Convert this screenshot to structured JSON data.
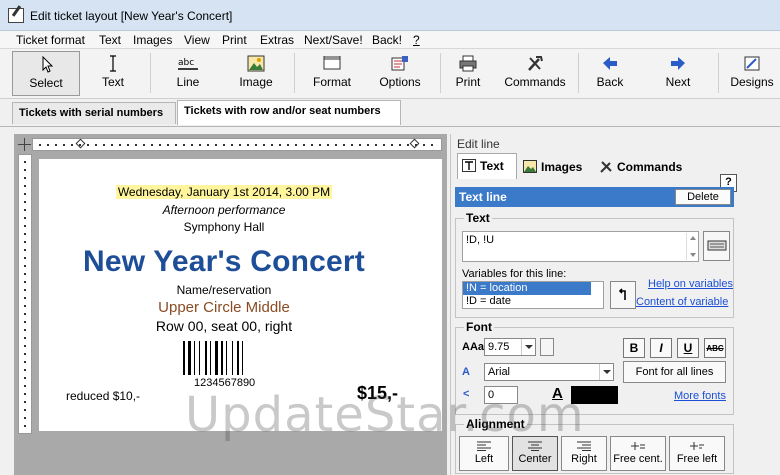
{
  "window": {
    "title": "Edit ticket layout [New Year's Concert]"
  },
  "menu": [
    "Ticket format",
    "Text",
    "Images",
    "View",
    "Print",
    "Extras",
    "Next/Save!",
    "Back!",
    "?"
  ],
  "toolbar": {
    "select": "Select",
    "text": "Text",
    "line": "Line",
    "image": "Image",
    "format": "Format",
    "options": "Options",
    "print": "Print",
    "commands": "Commands",
    "back": "Back",
    "next": "Next",
    "designs": "Designs",
    "line_icon_text": "abc"
  },
  "tabs": [
    "Tickets with serial numbers",
    "Tickets with row and/or seat numbers"
  ],
  "ticket": {
    "date": "Wednesday, January 1st 2014, 3.00 PM",
    "performance": "Afternoon performance",
    "location": "Symphony Hall",
    "title": "New Year's Concert",
    "name": "Name/reservation",
    "section": "Upper Circle Middle",
    "seat": "Row 00, seat 00, right",
    "barcode_number": "1234567890",
    "reduced": "reduced $10,-",
    "price": "$15,-"
  },
  "panel": {
    "title": "Edit line",
    "tabs": [
      "Text",
      "Images",
      "Commands"
    ],
    "help": "?",
    "text_line_label": "Text line",
    "delete": "Delete",
    "text_group": "Text",
    "text_value": "!D, !U",
    "variables_label": "Variables for this line:",
    "variables": [
      "!N = location",
      "!D = date"
    ],
    "help_on_variables": "Help on variables",
    "content_of_variable": "Content of variable",
    "font_group": "Font",
    "font_size_icon": "AAa",
    "font_size": "9.75",
    "font_name": "Arial",
    "font_for_all": "Font for all lines",
    "more_fonts": "More fonts",
    "spacing": "0",
    "bold": "B",
    "italic": "I",
    "underline": "U",
    "strike": "ABC",
    "alignment_group": "Alignment",
    "align": [
      "Left",
      "Center",
      "Right",
      "Free cent.",
      "Free left"
    ],
    "color": "#000000"
  },
  "watermark": "UpdateStar.com"
}
